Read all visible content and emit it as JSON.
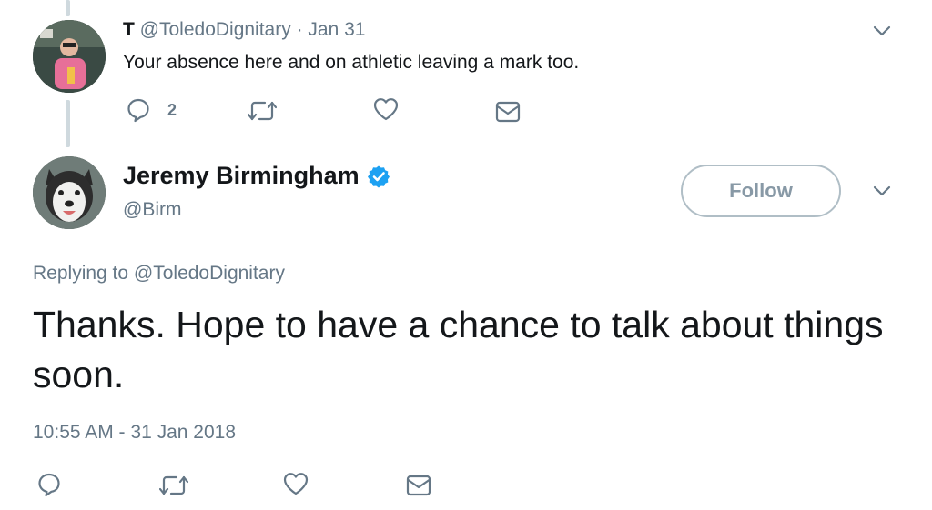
{
  "reply_tweet": {
    "display_name": "T",
    "handle": "@ToledoDignitary",
    "separator": "·",
    "date": "Jan 31",
    "text": "Your absence here and on athletic leaving a mark too.",
    "reply_count": "2",
    "icons": [
      "reply-icon",
      "retweet-icon",
      "like-icon",
      "message-icon",
      "chevron-down-icon"
    ]
  },
  "main_tweet": {
    "display_name": "Jeremy Birmingham",
    "handle": "@Birm",
    "verified": true,
    "follow_label": "Follow",
    "replying_prefix": "Replying to",
    "replying_to": "@ToledoDignitary",
    "text": "Thanks. Hope to have a chance to talk about things soon.",
    "timestamp": "10:55 AM - 31 Jan 2018",
    "icons": [
      "reply-icon",
      "retweet-icon",
      "like-icon",
      "message-icon",
      "chevron-down-icon",
      "verified-badge-icon"
    ]
  },
  "colors": {
    "text": "#14171a",
    "secondary": "#657786",
    "verified": "#1da1f2",
    "thread_line": "#cfd9de",
    "follow_border": "#b0bec6"
  }
}
